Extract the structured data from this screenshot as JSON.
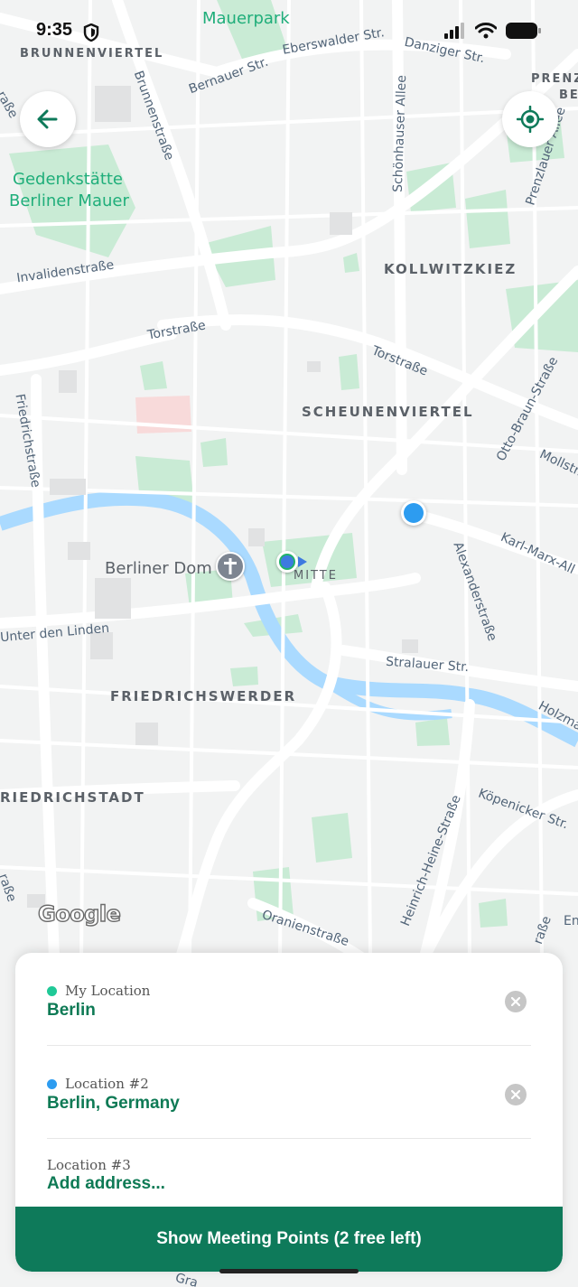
{
  "status_bar": {
    "time": "9:35"
  },
  "map": {
    "districts": [
      "BRUNNENVIERTEL",
      "KOLLWITZKIEZ",
      "SCHEUNENVIERTEL",
      "MITTE",
      "FRIEDRICHSWERDER",
      "RIEDRICHSTADT",
      "PRENZ",
      "BE"
    ],
    "parks": [
      "Mauerpark",
      "Gedenkstätte",
      "Berliner Mauer"
    ],
    "poi": "Berliner Dom",
    "streets": {
      "eberswalder": "Eberswalder Str.",
      "danziger": "Danziger Str.",
      "bernauer": "Bernauer Str.",
      "brunnen": "Brunnenstraße",
      "schoenhauser": "Schönhauser Allee",
      "prenzlauer": "Prenzlauer Allee",
      "invaliden": "Invalidenstraße",
      "tor1": "Torstraße",
      "tor2": "Torstraße",
      "friedrich": "Friedrichstraße",
      "ottobraun": "Otto-Braun-Straße",
      "moll": "Mollstr.",
      "karlmarx": "Karl-Marx-All",
      "alexander": "Alexanderstraße",
      "linden": "Unter den Linden",
      "stralauer": "Stralauer Str.",
      "holz": "Holzma",
      "koepenicker": "Köpenicker Str.",
      "heine": "Heinrich-Heine-Straße",
      "oranien": "Oranienstraße",
      "edge1": "raße",
      "edge2": "raße",
      "edge3": "raße",
      "edge4": "En",
      "edge5": "Gra"
    },
    "attribution": "Google"
  },
  "panel": {
    "locations": [
      {
        "caption": "My Location",
        "value": "Berlin",
        "dot_color": "#20c997"
      },
      {
        "caption": "Location #2",
        "value": "Berlin, Germany",
        "dot_color": "#2d9cf0"
      },
      {
        "caption": "Location #3",
        "value": "Add address..."
      }
    ],
    "cta_label": "Show Meeting Points (2 free left)"
  },
  "colors": {
    "brand": "#0e7a5a",
    "park": "#c9ebd5",
    "water": "#aadaff",
    "road": "#ffffff"
  },
  "icons": [
    "shield-icon",
    "signal-icon",
    "wifi-icon",
    "battery-icon",
    "back-arrow-icon",
    "my-location-icon",
    "cross-icon",
    "close-icon"
  ]
}
